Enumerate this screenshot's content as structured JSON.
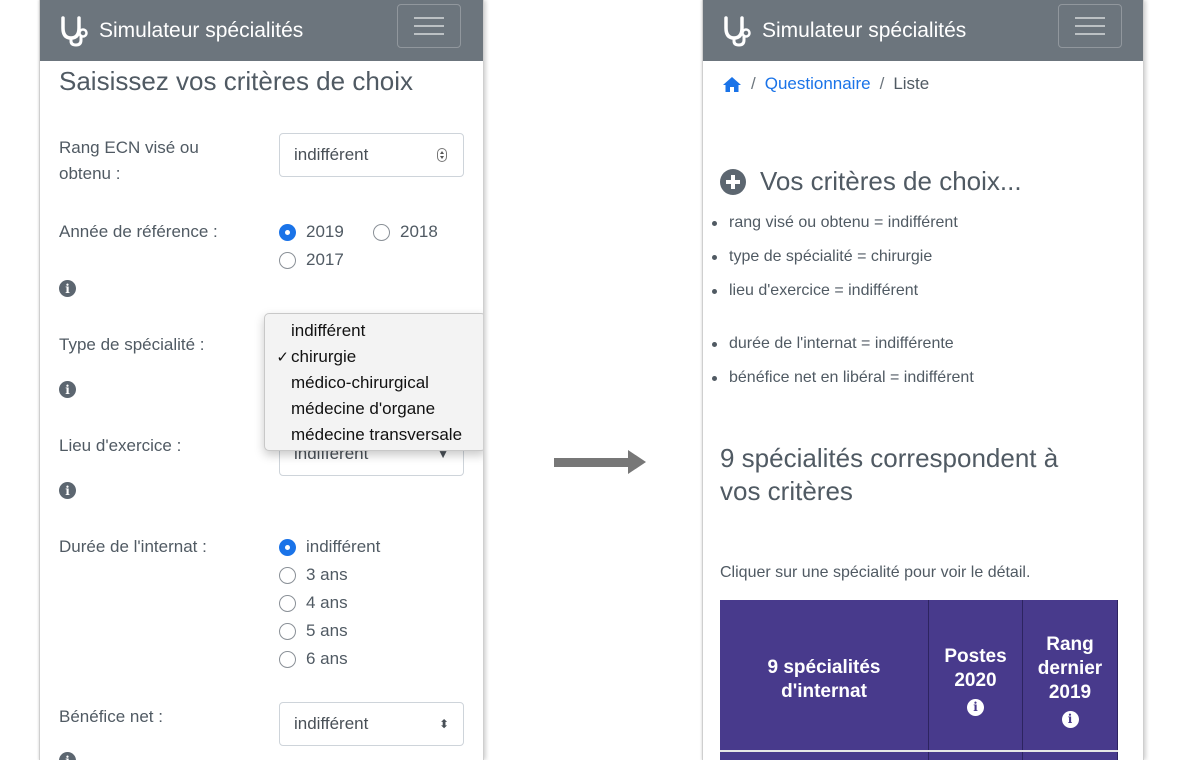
{
  "app": {
    "brand": "Simulateur spécialités",
    "brand_icon": "stethoscope-icon",
    "navbar_color": "#6c757d"
  },
  "form": {
    "title": "Saisissez vos critères de choix",
    "rang": {
      "label_line1": "Rang ECN visé ou",
      "label_line2": "obtenu :",
      "value": "indifférent"
    },
    "annee": {
      "label": "Année de référence :",
      "options": [
        "2019",
        "2018",
        "2017"
      ],
      "selected": "2019"
    },
    "type": {
      "label": "Type de spécialité :",
      "options": [
        "indifférent",
        "chirurgie",
        "médico-chirurgical",
        "médecine d'organe",
        "médecine transversale"
      ],
      "selected": "chirurgie"
    },
    "lieu": {
      "label": "Lieu d'exercice :",
      "value": "indifférent"
    },
    "duree": {
      "label": "Durée de l'internat :",
      "options": [
        "indifférent",
        "3 ans",
        "4 ans",
        "5 ans",
        "6 ans"
      ],
      "selected": "indifférent"
    },
    "benefice": {
      "label": "Bénéfice net :",
      "value": "indifférent"
    }
  },
  "results": {
    "breadcrumb": {
      "home_icon": "home-icon",
      "questionnaire": "Questionnaire",
      "current": "Liste",
      "separator": "/"
    },
    "criteria_title": "Vos critères de choix...",
    "criteria": [
      "rang visé ou obtenu = indifférent",
      "type de spécialité = chirurgie",
      "lieu d'exercice = indifférent",
      "durée de l'internat = indifférente",
      "bénéfice net en libéral = indifférent"
    ],
    "count_line1": "9 spécialités correspondent à",
    "count_line2": "vos critères",
    "hint": "Cliquer sur une spécialité pour voir le détail.",
    "table_header_color": "#483a8c",
    "columns": [
      {
        "lines": [
          "9 spécialités",
          "d'internat"
        ],
        "info": false
      },
      {
        "lines": [
          "Postes",
          "2020"
        ],
        "info": true
      },
      {
        "lines": [
          "Rang",
          "dernier",
          "2019"
        ],
        "info": true
      }
    ]
  },
  "accent_color": "#1a73e8"
}
